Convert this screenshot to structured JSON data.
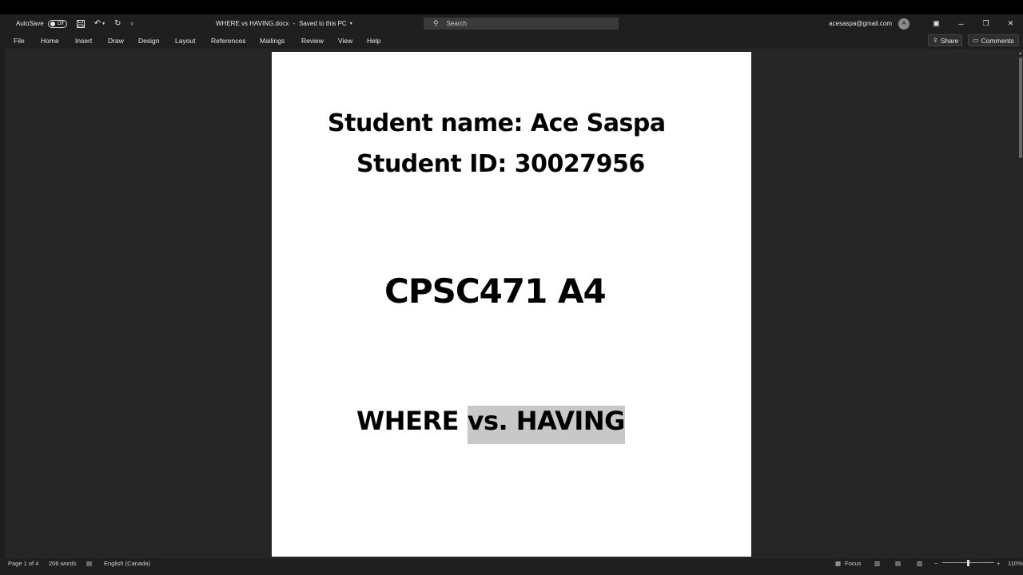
{
  "titlebar": {
    "autosave_label": "AutoSave",
    "autosave_state": "Off",
    "icons": [
      "save-icon",
      "undo-icon",
      "redo-icon",
      "customize-qat-icon"
    ],
    "document_name": "WHERE vs HAVING.docx",
    "separator": "-",
    "save_status": "Saved to this PC",
    "search_placeholder": "Search",
    "account": "acesaspa@gmail.com",
    "avatar_initial": "A"
  },
  "menu": {
    "items": [
      "File",
      "Home",
      "Insert",
      "Draw",
      "Design",
      "Layout",
      "References",
      "Mailings",
      "Review",
      "View",
      "Help"
    ],
    "share_label": "Share",
    "comments_label": "Comments"
  },
  "document": {
    "line1": "Student name: Ace Saspa",
    "line2": "Student ID: 30027956",
    "line3": "CPSC471 A4",
    "line4_prefix": "WHERE ",
    "line4_selected": "vs. HAVING"
  },
  "status": {
    "page": "Page 1 of 4",
    "words": "206 words",
    "language": "English (Canada)",
    "focus": "Focus",
    "zoom": "110%",
    "zoom_minus": "−",
    "zoom_plus": "+"
  }
}
